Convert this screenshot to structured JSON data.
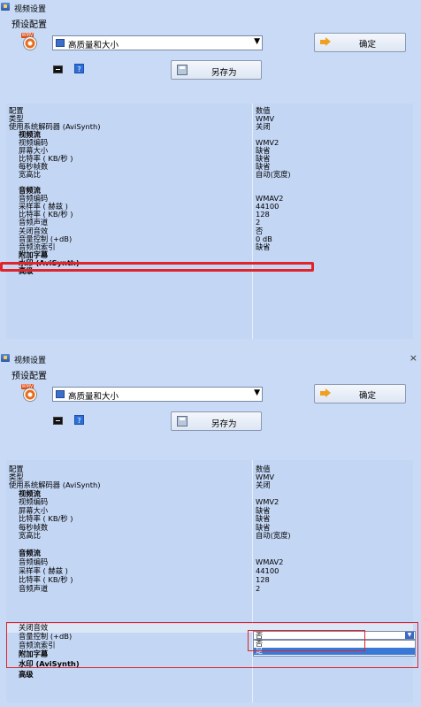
{
  "window": {
    "title": "视频设置",
    "close": "×"
  },
  "preset": {
    "label": "预设配置",
    "selected": "高质量和大小",
    "wmv_tag": "WMV",
    "confirm_label": "确定",
    "saveas_label": "另存为",
    "help": "?"
  },
  "header": {
    "key": "配置",
    "value": "数值"
  },
  "properties_1": [
    {
      "k": "类型",
      "v": "WMV"
    },
    {
      "k": "使用系统解码器 (AviSynth)",
      "v": "关闭"
    },
    {
      "k": "视频流",
      "v": ""
    },
    {
      "k": "视频编码",
      "v": "WMV2"
    },
    {
      "k": "屏幕大小",
      "v": "缺省"
    },
    {
      "k": "比特率 ( KB/秒 )",
      "v": "缺省"
    },
    {
      "k": "每秒帧数",
      "v": "缺省"
    },
    {
      "k": "宽高比",
      "v": "自动(宽度)"
    },
    {
      "k": "",
      "v": ""
    },
    {
      "k": "音频流",
      "v": ""
    },
    {
      "k": "音频编码",
      "v": "WMAV2"
    },
    {
      "k": "采样率 ( 赫兹 )",
      "v": "44100"
    },
    {
      "k": "比特率 ( KB/秒 )",
      "v": "128"
    },
    {
      "k": "音频声道",
      "v": "2"
    },
    {
      "k": "关闭音效",
      "v": "否"
    },
    {
      "k": "音量控制 (+dB)",
      "v": "0 dB"
    },
    {
      "k": "音频流索引",
      "v": "缺省"
    },
    {
      "k": "附加字幕",
      "v": ""
    },
    {
      "k": "水印 (AviSynth)",
      "v": ""
    },
    {
      "k": "高级",
      "v": ""
    }
  ],
  "properties_2": [
    {
      "k": "类型",
      "v": "WMV"
    },
    {
      "k": "使用系统解码器 (AviSynth)",
      "v": "关闭"
    },
    {
      "k": "视频流",
      "v": ""
    },
    {
      "k": "视频编码",
      "v": "WMV2"
    },
    {
      "k": "屏幕大小",
      "v": "缺省"
    },
    {
      "k": "比特率 ( KB/秒 )",
      "v": "缺省"
    },
    {
      "k": "每秒帧数",
      "v": "缺省"
    },
    {
      "k": "宽高比",
      "v": "自动(宽度)"
    },
    {
      "k": "",
      "v": ""
    },
    {
      "k": "音频流",
      "v": ""
    },
    {
      "k": "音频编码",
      "v": "WMAV2"
    },
    {
      "k": "采样率 ( 赫兹 )",
      "v": "44100"
    },
    {
      "k": "比特率 ( KB/秒 )",
      "v": "128"
    },
    {
      "k": "音频声道",
      "v": "2"
    },
    {
      "k": "关闭音效",
      "v": ""
    },
    {
      "k": "音量控制 (+dB)",
      "v": ""
    },
    {
      "k": "音频流索引",
      "v": ""
    },
    {
      "k": "附加字幕",
      "v": ""
    },
    {
      "k": "水印 (AviSynth)",
      "v": ""
    },
    {
      "k": "高级",
      "v": ""
    }
  ],
  "dropdown": {
    "current": "否",
    "options": [
      "否",
      "是"
    ]
  },
  "colors": {
    "panel_bg": "#c8daf5",
    "highlight_red": "#e0242a",
    "selected_option": "#3a78d8"
  }
}
